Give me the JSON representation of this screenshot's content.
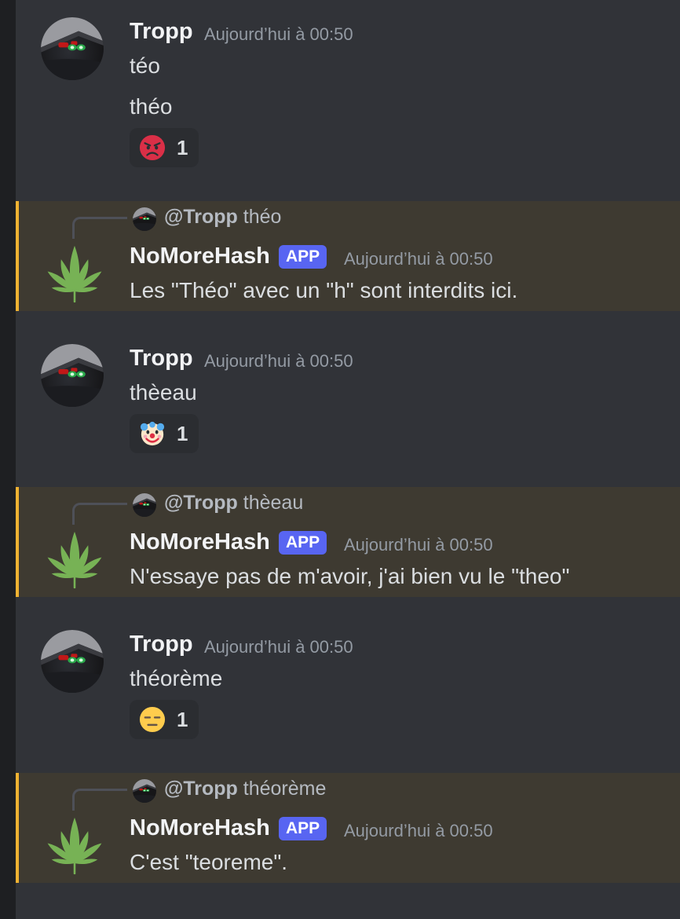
{
  "colors": {
    "background": "#313338",
    "mention_highlight": "#3e3a31",
    "mention_bar": "#f0b232",
    "app_badge": "#5865f2",
    "leaf_green": "#77b255"
  },
  "messages": [
    {
      "author": "Tropp",
      "timestamp": "Aujourd’hui à 00:50",
      "lines": [
        "téo",
        "théo"
      ],
      "reaction": {
        "icon": "angry-face-icon",
        "count": "1"
      }
    },
    {
      "reply_to": {
        "mention": "@Tropp",
        "text": "théo"
      },
      "author": "NoMoreHash",
      "badge": "APP",
      "timestamp": "Aujourd’hui à 00:50",
      "text": "Les \"Théo\" avec un \"h\" sont interdits ici."
    },
    {
      "author": "Tropp",
      "timestamp": "Aujourd’hui à 00:50",
      "lines": [
        "thèeau"
      ],
      "reaction": {
        "icon": "clown-face-icon",
        "count": "1"
      }
    },
    {
      "reply_to": {
        "mention": "@Tropp",
        "text": "thèeau"
      },
      "author": "NoMoreHash",
      "badge": "APP",
      "timestamp": "Aujourd’hui à 00:50",
      "text": "N'essaye pas de m'avoir, j'ai bien vu le \"theo\""
    },
    {
      "author": "Tropp",
      "timestamp": "Aujourd’hui à 00:50",
      "lines": [
        "théorème"
      ],
      "reaction": {
        "icon": "expressionless-face-icon",
        "count": "1"
      }
    },
    {
      "reply_to": {
        "mention": "@Tropp",
        "text": "théorème"
      },
      "author": "NoMoreHash",
      "badge": "APP",
      "timestamp": "Aujourd’hui à 00:50",
      "text": "C'est \"teoreme\"."
    }
  ]
}
